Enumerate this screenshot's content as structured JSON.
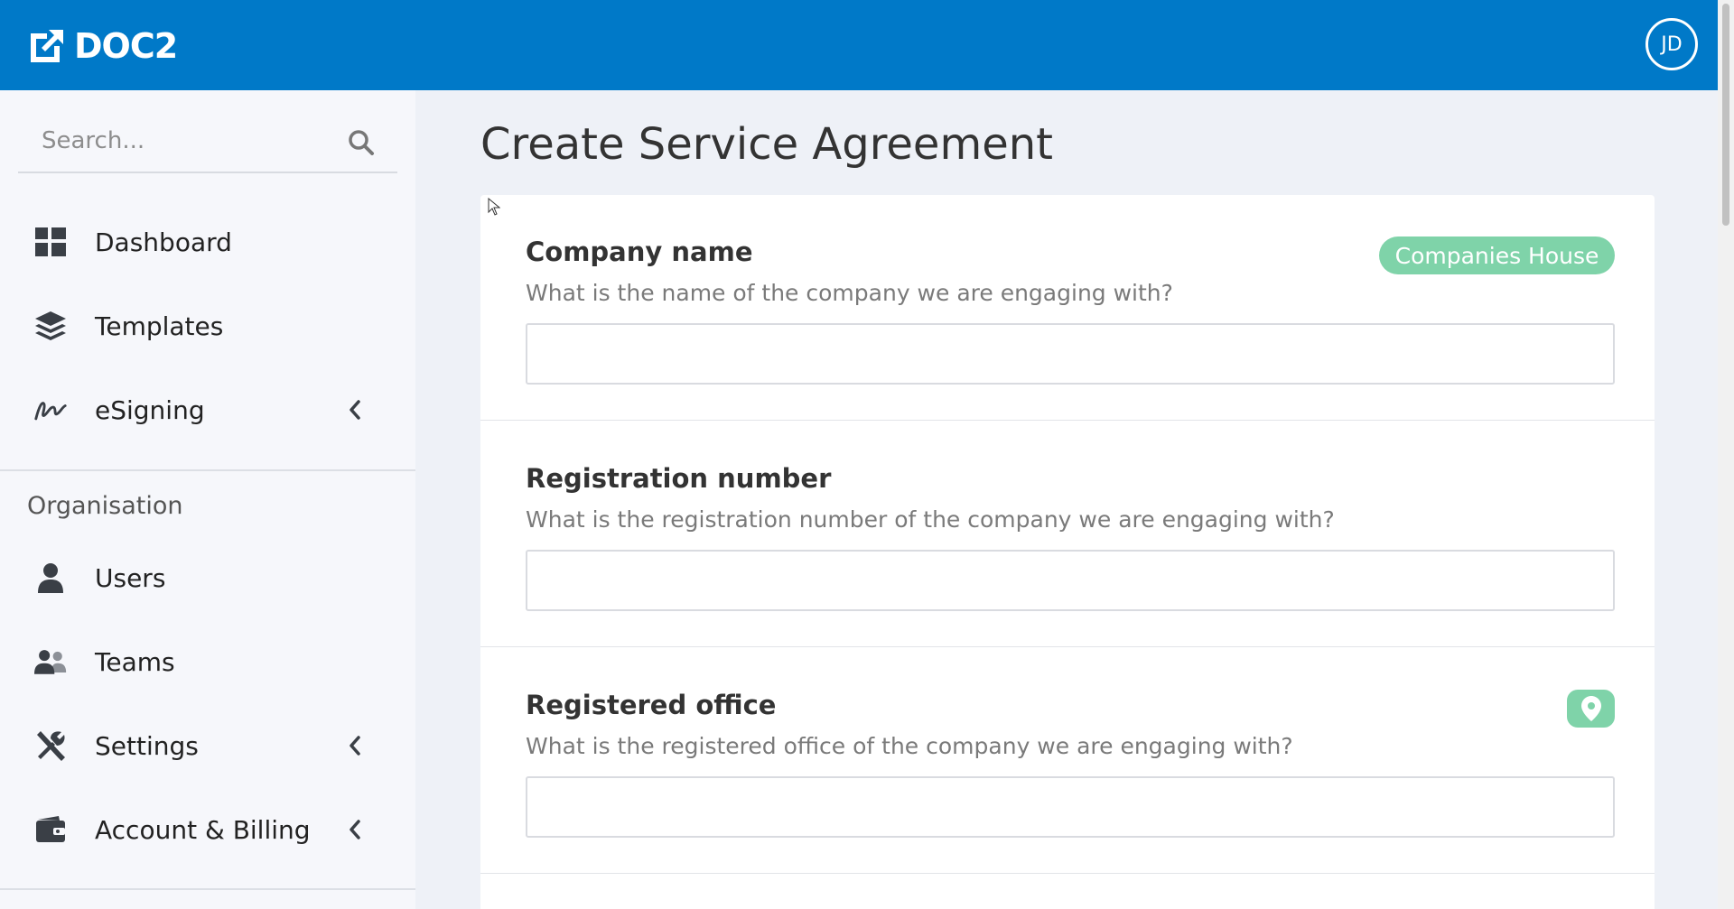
{
  "header": {
    "logo_text": "DOC2",
    "avatar_initials": "JD"
  },
  "sidebar": {
    "search_placeholder": "Search...",
    "items": [
      {
        "label": "Dashboard",
        "icon": "dashboard-grid-icon",
        "has_chevron": false
      },
      {
        "label": "Templates",
        "icon": "layers-icon",
        "has_chevron": false
      },
      {
        "label": "eSigning",
        "icon": "signature-icon",
        "has_chevron": true
      }
    ],
    "section_label": "Organisation",
    "org_items": [
      {
        "label": "Users",
        "icon": "user-icon",
        "has_chevron": false
      },
      {
        "label": "Teams",
        "icon": "users-icon",
        "has_chevron": false
      },
      {
        "label": "Settings",
        "icon": "tools-icon",
        "has_chevron": true
      },
      {
        "label": "Account & Billing",
        "icon": "wallet-icon",
        "has_chevron": true
      }
    ]
  },
  "main": {
    "title": "Create Service Agreement",
    "fields": [
      {
        "label": "Company name",
        "help": "What is the name of the company we are engaging with?",
        "value": "",
        "badge": "Companies House"
      },
      {
        "label": "Registration number",
        "help": "What is the registration number of the company we are engaging with?",
        "value": ""
      },
      {
        "label": "Registered office",
        "help": "What is the registered office of the company we are engaging with?",
        "value": "",
        "action_icon": "map-pin-icon"
      }
    ]
  },
  "colors": {
    "brand_blue": "#0079c8",
    "accent_green": "#7fd3a9",
    "sidebar_bg": "#f6f7fb",
    "page_bg": "#eef1f7"
  }
}
